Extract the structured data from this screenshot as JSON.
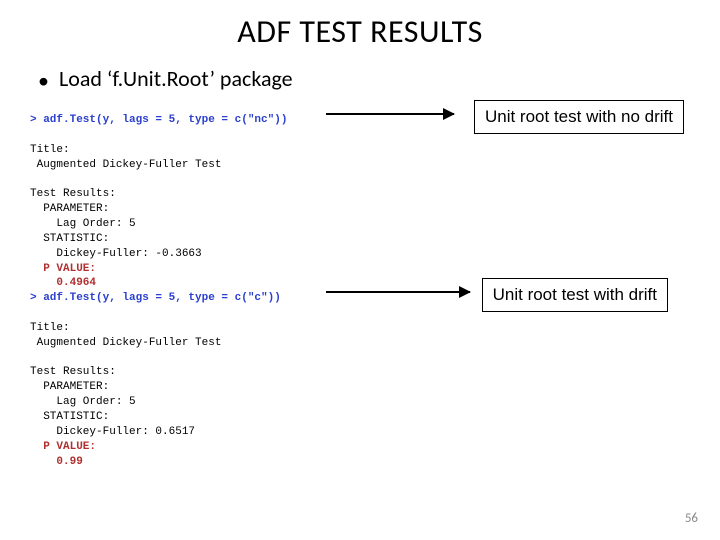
{
  "title": "ADF TEST RESULTS",
  "bullet": "Load ‘f.Unit.Root’ package",
  "cmd1": "> adf.Test(y, lags = 5, type = c(\"nc\"))",
  "block1": {
    "l1": "Title:",
    "l2": " Augmented Dickey-Fuller Test",
    "l3": "Test Results:",
    "l4": "  PARAMETER:",
    "l5": "    Lag Order: 5",
    "l6": "  STATISTIC:",
    "l7": "    Dickey-Fuller: -0.3663",
    "l8": "  P VALUE:",
    "l9": "    0.4964"
  },
  "cmd2": "> adf.Test(y, lags = 5, type = c(\"c\"))",
  "block2": {
    "l1": "Title:",
    "l2": " Augmented Dickey-Fuller Test",
    "l3": "Test Results:",
    "l4": "  PARAMETER:",
    "l5": "    Lag Order: 5",
    "l6": "  STATISTIC:",
    "l7": "    Dickey-Fuller: 0.6517",
    "l8": "  P VALUE:",
    "l9": "    0.99"
  },
  "label_box1": "Unit root test with no drift",
  "label_box2": "Unit root test with drift",
  "page_number": "56"
}
